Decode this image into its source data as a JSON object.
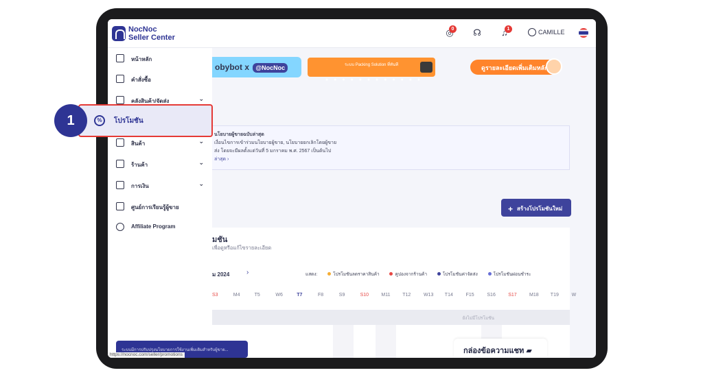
{
  "header": {
    "brand_line1": "NocNoc",
    "brand_line2": "Seller Center",
    "coins_badge": "0",
    "bell_badge": "1",
    "username": "CAMILLE",
    "icons": [
      "coins-icon",
      "support-icon",
      "bell-icon",
      "user-icon",
      "thai-flag-icon"
    ]
  },
  "sidebar": {
    "items": [
      {
        "label": "หน้าหลัก",
        "icon": "home-icon",
        "chevron": false
      },
      {
        "label": "คำสั่งซื้อ",
        "icon": "orders-icon",
        "chevron": false
      },
      {
        "label": "คลังสินค้า/จัดส่ง",
        "icon": "warehouse-icon",
        "chevron": true
      },
      {
        "label": "โปรโมชัน",
        "icon": "promotion-icon",
        "chevron": false
      },
      {
        "label": "สินค้า",
        "icon": "product-icon",
        "chevron": true
      },
      {
        "label": "ร้านค้า",
        "icon": "store-icon",
        "chevron": true
      },
      {
        "label": "การเงิน",
        "icon": "finance-icon",
        "chevron": true
      },
      {
        "label": "ศูนย์การเรียนรู้ผู้ขาย",
        "icon": "learning-icon",
        "chevron": false
      },
      {
        "label": "Affiliate Program",
        "icon": "link-icon",
        "chevron": false
      }
    ],
    "url": "https://nocnoc.com/seller/promotions",
    "toast_text": "ระบบมีการปรับปรุงนโยบายการใช้งานเพิ่มเติมสำหรับผู้ขาย..."
  },
  "banner": {
    "left_text": "obybot x",
    "left_brand": "@NocNoc",
    "middle_text": "ระบบ Packing Solution ที่ทันที",
    "right_text": "ดูรายละเอียดเพิ่มเติมหลัก",
    "dots": "● ● ● ● ● ● ● ● ● ● ● ●"
  },
  "notice": {
    "title": "นโยบายผู้ขายฉบับล่าสุด",
    "line1": "เงื่อนไขการเข้าร่วมนโยบายผู้ขาย, นโยบายยกเลิกโดยผู้ขาย",
    "line2": "ส่ง โดยจะมีผลตั้งแต่วันที่ 5 มกราคม พ.ศ. 2567 เป็นต้นไป",
    "link": "ล่าสุด ›"
  },
  "create_button": "สร้างโปรโมชันใหม่",
  "panel": {
    "title": "มชัน",
    "subtitle": "เพื่อดูหรือแก้ไขรายละเอียด",
    "month": "ม 2024",
    "legend_label": "แสดง:",
    "legend": [
      {
        "label": "โปรโมชันลดราคาสินค้า",
        "color": "#f5a623"
      },
      {
        "label": "คูปองจากร้านค้า",
        "color": "#e53935"
      },
      {
        "label": "โปรโมชันค่าจัดส่ง",
        "color": "#2e3494"
      },
      {
        "label": "โปรโมชันผ่อนชำระ",
        "color": "#5b63d3"
      }
    ],
    "days": [
      {
        "label": "S3",
        "type": "red"
      },
      {
        "label": "M4",
        "type": ""
      },
      {
        "label": "T5",
        "type": ""
      },
      {
        "label": "W6",
        "type": ""
      },
      {
        "label": "T7",
        "type": "blue"
      },
      {
        "label": "F8",
        "type": ""
      },
      {
        "label": "S9",
        "type": ""
      },
      {
        "label": "S10",
        "type": "red"
      },
      {
        "label": "M11",
        "type": ""
      },
      {
        "label": "T12",
        "type": ""
      },
      {
        "label": "W13",
        "type": ""
      },
      {
        "label": "T14",
        "type": ""
      },
      {
        "label": "F15",
        "type": ""
      },
      {
        "label": "S16",
        "type": ""
      },
      {
        "label": "S17",
        "type": "red"
      },
      {
        "label": "M18",
        "type": ""
      },
      {
        "label": "T19",
        "type": ""
      },
      {
        "label": "W",
        "type": ""
      }
    ],
    "empty_text": "ยังไม่มีโปรโมชัน"
  },
  "chat_button": "กล่องข้อความแชท",
  "callout": {
    "step_number": "1",
    "label": "โปรโมชัน"
  },
  "colors": {
    "brand": "#2e3494",
    "highlight_border": "#e53935"
  }
}
